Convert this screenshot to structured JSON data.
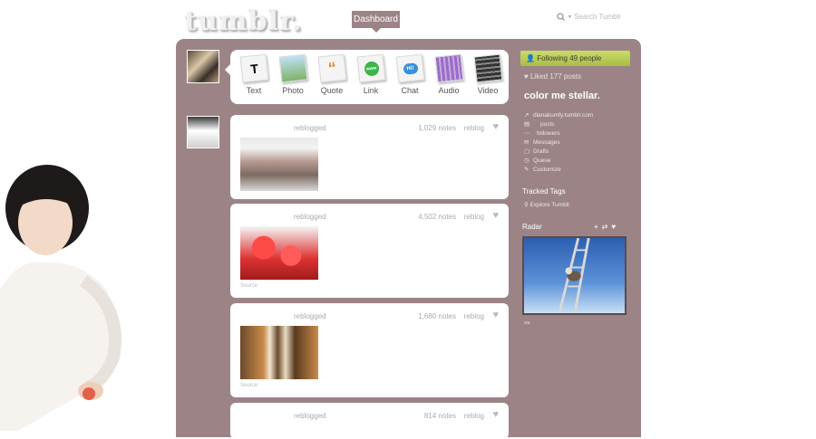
{
  "header": {
    "logo_text": "tumblr.",
    "dashboard_tab": "Dashboard",
    "search_placeholder": "Search Tumblr"
  },
  "post_types": [
    {
      "label": "Text",
      "icon": "text-icon"
    },
    {
      "label": "Photo",
      "icon": "photo-icon"
    },
    {
      "label": "Quote",
      "icon": "quote-icon"
    },
    {
      "label": "Link",
      "icon": "link-icon"
    },
    {
      "label": "Chat",
      "icon": "chat-icon"
    },
    {
      "label": "Audio",
      "icon": "audio-icon"
    },
    {
      "label": "Video",
      "icon": "video-icon"
    }
  ],
  "posts": [
    {
      "reblogged": "reblogged",
      "notes": "1,029 notes",
      "reblog": "reblog",
      "source": ""
    },
    {
      "reblogged": "reblogged",
      "notes": "4,502 notes",
      "reblog": "reblog",
      "source": "Source:"
    },
    {
      "reblogged": "reblogged",
      "notes": "1,680 notes",
      "reblog": "reblog",
      "source": "Source:"
    },
    {
      "reblogged": "reblogged",
      "notes": "814 notes",
      "reblog": "reblog",
      "source": ""
    }
  ],
  "sidebar": {
    "following": "Following 49 people",
    "liked": "Liked 177 posts",
    "blog_title": "color me stellar.",
    "items": [
      {
        "label": "dianakumfy.tumblr.com",
        "icon": "external-link-icon"
      },
      {
        "label": "posts",
        "icon": "posts-icon"
      },
      {
        "label": "followers",
        "icon": "followers-icon"
      },
      {
        "label": "Messages",
        "icon": "mail-icon"
      },
      {
        "label": "Drafts",
        "icon": "drafts-icon"
      },
      {
        "label": "Queue",
        "icon": "queue-icon"
      },
      {
        "label": "Customize",
        "icon": "wrench-icon"
      }
    ],
    "tracked_tags": "Tracked Tags",
    "explore": "Explore Tumblr",
    "radar": "Radar",
    "radar_via": "via"
  },
  "colors": {
    "panel": "#9c8486",
    "follow_green": "#b5c955",
    "card": "#ffffff"
  }
}
